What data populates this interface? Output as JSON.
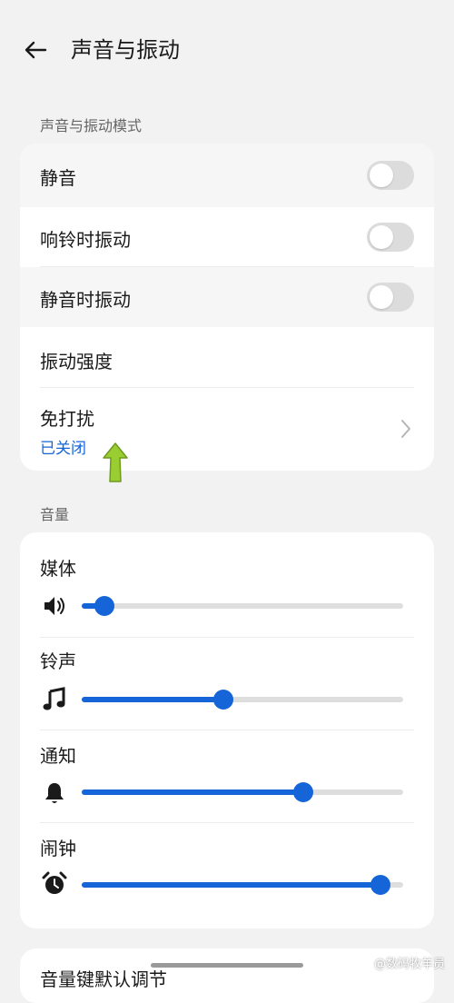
{
  "header": {
    "title": "声音与振动"
  },
  "mode_section": {
    "label": "声音与振动模式",
    "toggles": [
      {
        "label": "静音",
        "on": false
      },
      {
        "label": "响铃时振动",
        "on": false
      },
      {
        "label": "静音时振动",
        "on": false
      }
    ],
    "vibration_strength": {
      "label": "振动强度"
    },
    "dnd": {
      "label": "免打扰",
      "status": "已关闭"
    }
  },
  "volume_section": {
    "label": "音量",
    "items": [
      {
        "label": "媒体",
        "icon": "speaker-icon",
        "level": 0.07
      },
      {
        "label": "铃声",
        "icon": "music-note-icon",
        "level": 0.44
      },
      {
        "label": "通知",
        "icon": "bell-icon",
        "level": 0.69
      },
      {
        "label": "闹钟",
        "icon": "alarm-clock-icon",
        "level": 0.93
      }
    ]
  },
  "bottom": {
    "label": "音量键默认调节"
  },
  "watermark": "@数码牧羊员",
  "colors": {
    "accent": "#1565d8",
    "background": "#f2f2f2",
    "card": "#ffffff",
    "arrow": "#9acd32"
  }
}
